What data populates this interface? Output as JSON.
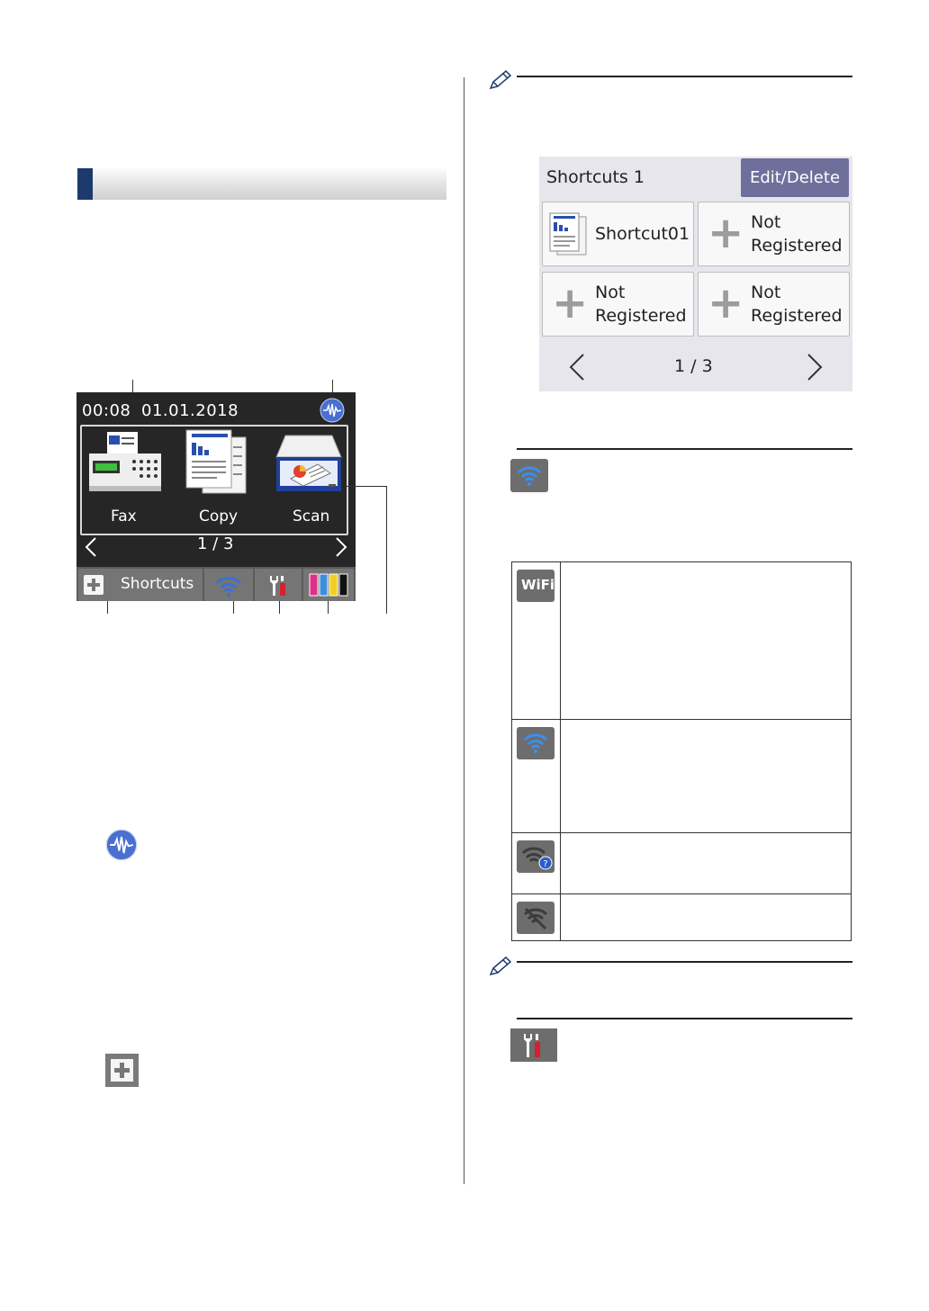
{
  "lcd": {
    "time": "00:08",
    "date": "01.01.2018",
    "apps": [
      {
        "label": "Fax",
        "icon": "fax-machine-icon"
      },
      {
        "label": "Copy",
        "icon": "copy-documents-icon"
      },
      {
        "label": "Scan",
        "icon": "scanner-icon"
      }
    ],
    "page_indicator": "1 / 3",
    "shortcuts_label": "Shortcuts"
  },
  "shortcuts_screen": {
    "title": "Shortcuts 1",
    "edit_label": "Edit/Delete",
    "tiles": [
      {
        "line1": "Shortcut01",
        "line2": ""
      },
      {
        "line1": "Not",
        "line2": "Registered"
      },
      {
        "line1": "Not",
        "line2": "Registered"
      },
      {
        "line1": "Not",
        "line2": "Registered"
      }
    ],
    "page_indicator": "1 / 3"
  },
  "table_icons": {
    "wifi_text": "WiFi"
  },
  "colors": {
    "accent_blue": "#1d3a6e",
    "edit_button": "#6f6f9c",
    "wifi_blue": "#3a6fd8"
  }
}
